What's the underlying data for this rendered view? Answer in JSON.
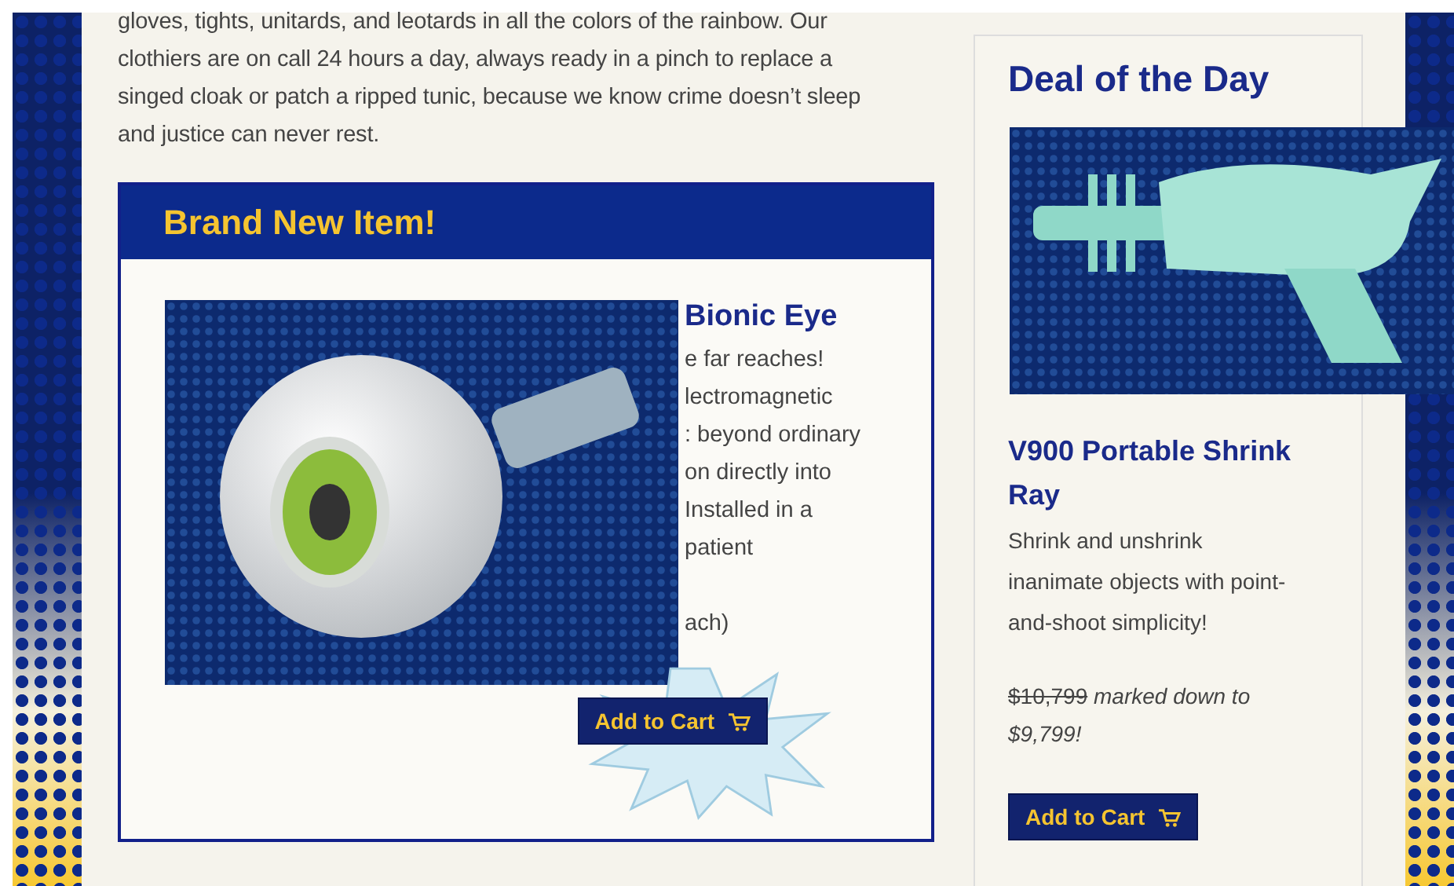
{
  "intro": "gloves, tights, unitards, and leotards in all the colors of the rainbow. Our clothiers are on call 24 hours a day, always ready in a pinch to replace a singed cloak or patch a ripped tunic, because we know crime doesn’t sleep and justice can never rest.",
  "featured": {
    "heading": "Brand New Item!",
    "title": "Bionic Eye",
    "lines": [
      "e far reaches!",
      "lectromagnetic",
      ": beyond ordinary",
      "on directly into",
      " Installed in a",
      "patient"
    ],
    "last_line": "ach)",
    "button": "Add to Cart"
  },
  "deal": {
    "heading": "Deal of the Day",
    "title": "V900 Portable Shrink Ray",
    "description": "Shrink and unshrink inanimate objects with point-and-shoot simplicity!",
    "old_price": "$10,799",
    "note": "marked down to",
    "price": "$9,799!",
    "button": "Add to Cart"
  }
}
